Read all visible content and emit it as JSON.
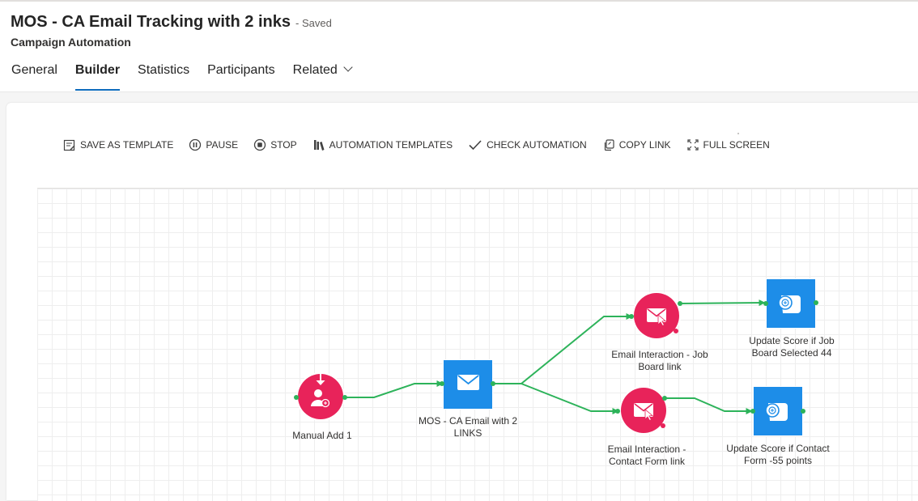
{
  "record": {
    "title": "MOS - CA Email Tracking with 2  inks",
    "status": "- Saved",
    "entity": "Campaign Automation"
  },
  "tabs": [
    {
      "label": "General",
      "active": false
    },
    {
      "label": "Builder",
      "active": true
    },
    {
      "label": "Statistics",
      "active": false
    },
    {
      "label": "Participants",
      "active": false
    },
    {
      "label": "Related",
      "active": false
    }
  ],
  "toolbar": {
    "save_template": "SAVE AS TEMPLATE",
    "pause": "PAUSE",
    "stop": "STOP",
    "automation_templates": "AUTOMATION TEMPLATES",
    "check_automation": "CHECK AUTOMATION",
    "copy_link": "COPY LINK",
    "full_screen": "FULL SCREEN"
  },
  "flow": {
    "nodes": [
      {
        "id": "manual-add",
        "kind": "trigger",
        "icon": "manual-add-icon",
        "label_lines": [
          "Manual Add 1"
        ]
      },
      {
        "id": "email",
        "kind": "email",
        "icon": "envelope-icon",
        "label_lines": [
          "MOS - CA Email with 2",
          "LINKS"
        ]
      },
      {
        "id": "interaction-job",
        "kind": "email-interaction",
        "icon": "email-interaction-icon",
        "label_lines": [
          "Email Interaction - Job",
          "Board link"
        ]
      },
      {
        "id": "interaction-contact",
        "kind": "email-interaction",
        "icon": "email-interaction-icon",
        "label_lines": [
          "Email Interaction -",
          "Contact Form link"
        ]
      },
      {
        "id": "score-job",
        "kind": "update-score",
        "icon": "score-icon",
        "label_lines": [
          "Update Score if Job",
          "Board Selected 44"
        ]
      },
      {
        "id": "score-contact",
        "kind": "update-score",
        "icon": "score-icon",
        "label_lines": [
          "Update Score if Contact",
          "Form -55 points"
        ]
      }
    ]
  },
  "colors": {
    "accent": "#0f6cbd",
    "trigger_red": "#e8235a",
    "action_blue": "#1d8de8",
    "connector_green": "#2db35a",
    "grid": "#eeeeee"
  }
}
